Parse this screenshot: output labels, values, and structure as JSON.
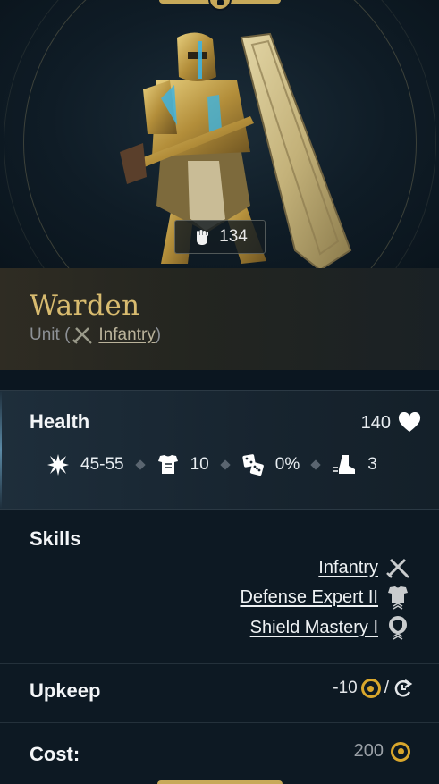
{
  "unit": {
    "power": "134",
    "name": "Warden",
    "type_prefix": "Unit (",
    "type_link": "Infantry",
    "type_suffix": ")"
  },
  "health": {
    "label": "Health",
    "value": "140"
  },
  "stats": {
    "damage": "45-55",
    "armor": "10",
    "chance": "0%",
    "movement": "3"
  },
  "skills": {
    "label": "Skills",
    "items": [
      {
        "label": "Infantry",
        "icon": "infantry-swords-icon"
      },
      {
        "label": "Defense Expert II",
        "icon": "defense-expert-icon"
      },
      {
        "label": "Shield Mastery I",
        "icon": "shield-mastery-icon"
      }
    ]
  },
  "upkeep": {
    "label": "Upkeep",
    "value": "-10",
    "separator": "/"
  },
  "cost": {
    "label": "Cost:",
    "value": "200"
  },
  "colors": {
    "gold": "#d9a72c",
    "name_gold": "#d8bb6f",
    "background": "#0b1620"
  }
}
